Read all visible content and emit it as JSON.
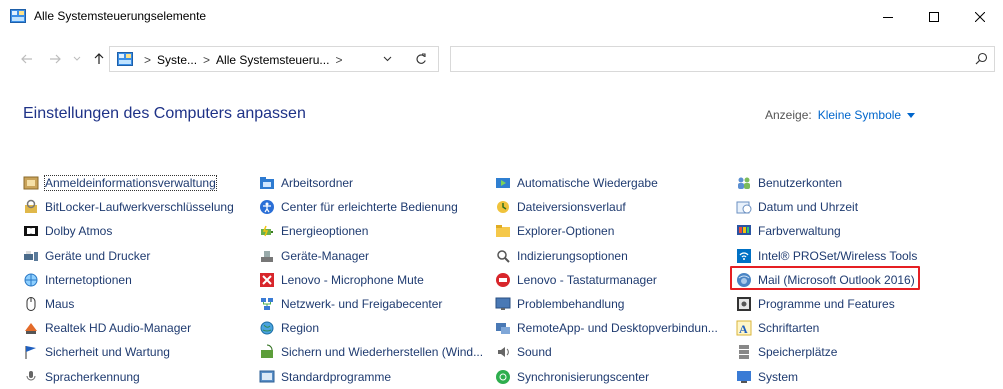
{
  "window": {
    "title": "Alle Systemsteuerungselemente",
    "accent_color": "#1e3287",
    "highlight_color": "#e51f23"
  },
  "address": {
    "crumb1": "Syste...",
    "crumb2": "Alle Systemsteueru...",
    "sep": ">"
  },
  "search": {
    "placeholder": ""
  },
  "header": {
    "heading": "Einstellungen des Computers anpassen",
    "view_label": "Anzeige:",
    "view_value": "Kleine Symbole"
  },
  "columns": [
    [
      {
        "label": "Anmeldeinformationsverwaltung",
        "icon": "credential-manager-icon"
      },
      {
        "label": "BitLocker-Laufwerkverschlüsselung",
        "icon": "bitlocker-icon"
      },
      {
        "label": "Dolby Atmos",
        "icon": "dolby-icon"
      },
      {
        "label": "Geräte und Drucker",
        "icon": "devices-printers-icon"
      },
      {
        "label": "Internetoptionen",
        "icon": "internet-options-icon"
      },
      {
        "label": "Maus",
        "icon": "mouse-icon"
      },
      {
        "label": "Realtek HD Audio-Manager",
        "icon": "realtek-audio-icon"
      },
      {
        "label": "Sicherheit und Wartung",
        "icon": "security-flag-icon"
      },
      {
        "label": "Spracherkennung",
        "icon": "speech-icon"
      }
    ],
    [
      {
        "label": "Arbeitsordner",
        "icon": "work-folders-icon"
      },
      {
        "label": "Center für erleichterte Bedienung",
        "icon": "ease-of-access-icon"
      },
      {
        "label": "Energieoptionen",
        "icon": "power-options-icon"
      },
      {
        "label": "Geräte-Manager",
        "icon": "device-manager-icon"
      },
      {
        "label": "Lenovo - Microphone Mute",
        "icon": "lenovo-mic-mute-icon"
      },
      {
        "label": "Netzwerk- und Freigabecenter",
        "icon": "network-center-icon"
      },
      {
        "label": "Region",
        "icon": "region-icon"
      },
      {
        "label": "Sichern und Wiederherstellen (Wind...",
        "icon": "backup-restore-icon"
      },
      {
        "label": "Standardprogramme",
        "icon": "default-programs-icon"
      }
    ],
    [
      {
        "label": "Automatische Wiedergabe",
        "icon": "autoplay-icon"
      },
      {
        "label": "Dateiversionsverlauf",
        "icon": "file-history-icon"
      },
      {
        "label": "Explorer-Optionen",
        "icon": "explorer-options-icon"
      },
      {
        "label": "Indizierungsoptionen",
        "icon": "indexing-options-icon"
      },
      {
        "label": "Lenovo - Tastaturmanager",
        "icon": "lenovo-keyboard-icon"
      },
      {
        "label": "Problembehandlung",
        "icon": "troubleshooting-icon"
      },
      {
        "label": "RemoteApp- und Desktopverbindun...",
        "icon": "remoteapp-icon"
      },
      {
        "label": "Sound",
        "icon": "sound-icon"
      },
      {
        "label": "Synchronisierungscenter",
        "icon": "sync-center-icon"
      }
    ],
    [
      {
        "label": "Benutzerkonten",
        "icon": "user-accounts-icon"
      },
      {
        "label": "Datum und Uhrzeit",
        "icon": "date-time-icon"
      },
      {
        "label": "Farbverwaltung",
        "icon": "color-management-icon"
      },
      {
        "label": "Intel® PROSet/Wireless Tools",
        "icon": "intel-wireless-icon"
      },
      {
        "label": "Mail (Microsoft Outlook 2016)",
        "icon": "mail-outlook-icon"
      },
      {
        "label": "Programme und Features",
        "icon": "programs-features-icon"
      },
      {
        "label": "Schriftarten",
        "icon": "fonts-icon"
      },
      {
        "label": "Speicherplätze",
        "icon": "storage-spaces-icon"
      },
      {
        "label": "System",
        "icon": "system-icon"
      }
    ]
  ]
}
